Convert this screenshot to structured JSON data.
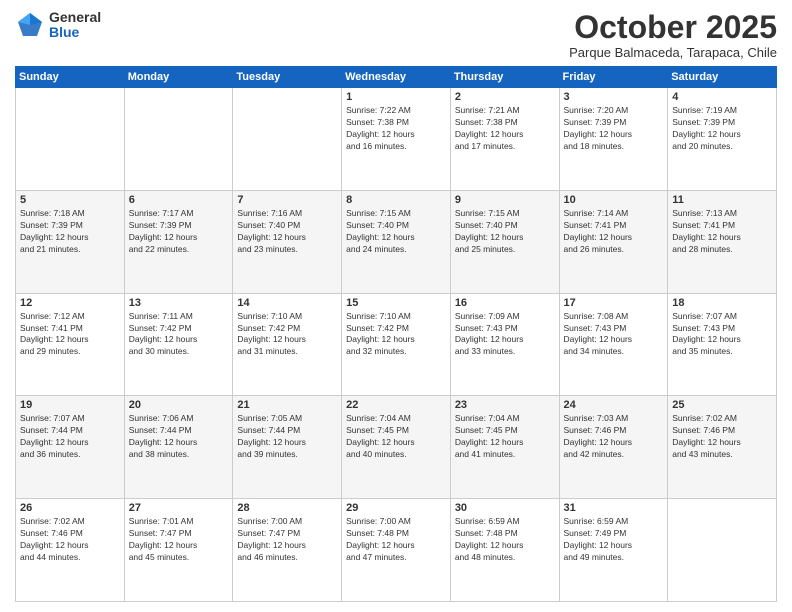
{
  "logo": {
    "general": "General",
    "blue": "Blue"
  },
  "header": {
    "month": "October 2025",
    "location": "Parque Balmaceda, Tarapaca, Chile"
  },
  "weekdays": [
    "Sunday",
    "Monday",
    "Tuesday",
    "Wednesday",
    "Thursday",
    "Friday",
    "Saturday"
  ],
  "weeks": [
    [
      {
        "day": "",
        "info": ""
      },
      {
        "day": "",
        "info": ""
      },
      {
        "day": "",
        "info": ""
      },
      {
        "day": "1",
        "info": "Sunrise: 7:22 AM\nSunset: 7:38 PM\nDaylight: 12 hours\nand 16 minutes."
      },
      {
        "day": "2",
        "info": "Sunrise: 7:21 AM\nSunset: 7:38 PM\nDaylight: 12 hours\nand 17 minutes."
      },
      {
        "day": "3",
        "info": "Sunrise: 7:20 AM\nSunset: 7:39 PM\nDaylight: 12 hours\nand 18 minutes."
      },
      {
        "day": "4",
        "info": "Sunrise: 7:19 AM\nSunset: 7:39 PM\nDaylight: 12 hours\nand 20 minutes."
      }
    ],
    [
      {
        "day": "5",
        "info": "Sunrise: 7:18 AM\nSunset: 7:39 PM\nDaylight: 12 hours\nand 21 minutes."
      },
      {
        "day": "6",
        "info": "Sunrise: 7:17 AM\nSunset: 7:39 PM\nDaylight: 12 hours\nand 22 minutes."
      },
      {
        "day": "7",
        "info": "Sunrise: 7:16 AM\nSunset: 7:40 PM\nDaylight: 12 hours\nand 23 minutes."
      },
      {
        "day": "8",
        "info": "Sunrise: 7:15 AM\nSunset: 7:40 PM\nDaylight: 12 hours\nand 24 minutes."
      },
      {
        "day": "9",
        "info": "Sunrise: 7:15 AM\nSunset: 7:40 PM\nDaylight: 12 hours\nand 25 minutes."
      },
      {
        "day": "10",
        "info": "Sunrise: 7:14 AM\nSunset: 7:41 PM\nDaylight: 12 hours\nand 26 minutes."
      },
      {
        "day": "11",
        "info": "Sunrise: 7:13 AM\nSunset: 7:41 PM\nDaylight: 12 hours\nand 28 minutes."
      }
    ],
    [
      {
        "day": "12",
        "info": "Sunrise: 7:12 AM\nSunset: 7:41 PM\nDaylight: 12 hours\nand 29 minutes."
      },
      {
        "day": "13",
        "info": "Sunrise: 7:11 AM\nSunset: 7:42 PM\nDaylight: 12 hours\nand 30 minutes."
      },
      {
        "day": "14",
        "info": "Sunrise: 7:10 AM\nSunset: 7:42 PM\nDaylight: 12 hours\nand 31 minutes."
      },
      {
        "day": "15",
        "info": "Sunrise: 7:10 AM\nSunset: 7:42 PM\nDaylight: 12 hours\nand 32 minutes."
      },
      {
        "day": "16",
        "info": "Sunrise: 7:09 AM\nSunset: 7:43 PM\nDaylight: 12 hours\nand 33 minutes."
      },
      {
        "day": "17",
        "info": "Sunrise: 7:08 AM\nSunset: 7:43 PM\nDaylight: 12 hours\nand 34 minutes."
      },
      {
        "day": "18",
        "info": "Sunrise: 7:07 AM\nSunset: 7:43 PM\nDaylight: 12 hours\nand 35 minutes."
      }
    ],
    [
      {
        "day": "19",
        "info": "Sunrise: 7:07 AM\nSunset: 7:44 PM\nDaylight: 12 hours\nand 36 minutes."
      },
      {
        "day": "20",
        "info": "Sunrise: 7:06 AM\nSunset: 7:44 PM\nDaylight: 12 hours\nand 38 minutes."
      },
      {
        "day": "21",
        "info": "Sunrise: 7:05 AM\nSunset: 7:44 PM\nDaylight: 12 hours\nand 39 minutes."
      },
      {
        "day": "22",
        "info": "Sunrise: 7:04 AM\nSunset: 7:45 PM\nDaylight: 12 hours\nand 40 minutes."
      },
      {
        "day": "23",
        "info": "Sunrise: 7:04 AM\nSunset: 7:45 PM\nDaylight: 12 hours\nand 41 minutes."
      },
      {
        "day": "24",
        "info": "Sunrise: 7:03 AM\nSunset: 7:46 PM\nDaylight: 12 hours\nand 42 minutes."
      },
      {
        "day": "25",
        "info": "Sunrise: 7:02 AM\nSunset: 7:46 PM\nDaylight: 12 hours\nand 43 minutes."
      }
    ],
    [
      {
        "day": "26",
        "info": "Sunrise: 7:02 AM\nSunset: 7:46 PM\nDaylight: 12 hours\nand 44 minutes."
      },
      {
        "day": "27",
        "info": "Sunrise: 7:01 AM\nSunset: 7:47 PM\nDaylight: 12 hours\nand 45 minutes."
      },
      {
        "day": "28",
        "info": "Sunrise: 7:00 AM\nSunset: 7:47 PM\nDaylight: 12 hours\nand 46 minutes."
      },
      {
        "day": "29",
        "info": "Sunrise: 7:00 AM\nSunset: 7:48 PM\nDaylight: 12 hours\nand 47 minutes."
      },
      {
        "day": "30",
        "info": "Sunrise: 6:59 AM\nSunset: 7:48 PM\nDaylight: 12 hours\nand 48 minutes."
      },
      {
        "day": "31",
        "info": "Sunrise: 6:59 AM\nSunset: 7:49 PM\nDaylight: 12 hours\nand 49 minutes."
      },
      {
        "day": "",
        "info": ""
      }
    ]
  ]
}
